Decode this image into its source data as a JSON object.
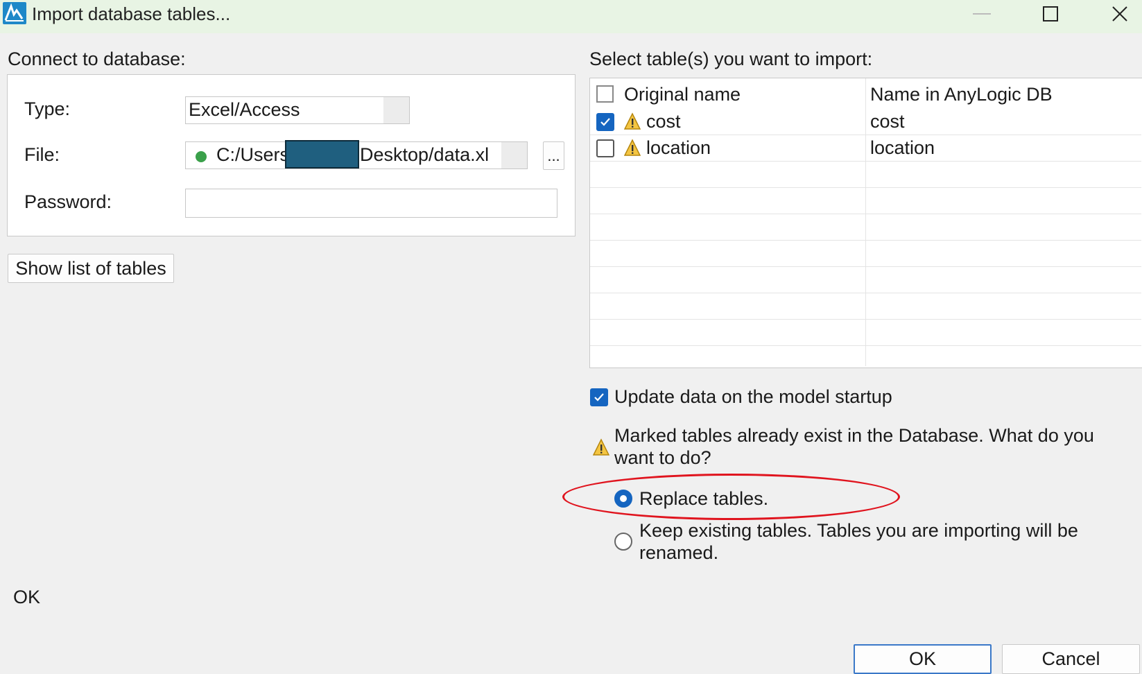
{
  "window": {
    "title": "Import database tables...",
    "icon": "anylogic-app-icon",
    "controls": [
      "minimize",
      "maximize",
      "close"
    ]
  },
  "connect": {
    "group_label": "Connect to database:",
    "type_label": "Type:",
    "type_value": "Excel/Access",
    "file_label": "File:",
    "file_value_prefix": "C:/Users",
    "file_value_suffix": "Desktop/data.xl",
    "file_status_color": "#3aa04a",
    "browse_label": "...",
    "password_label": "Password:",
    "password_value": "",
    "show_tables_label": "Show list of tables"
  },
  "tables": {
    "group_label": "Select table(s) you want to import:",
    "columns": [
      "Original name",
      "Name in AnyLogic DB"
    ],
    "rows": [
      {
        "checked": true,
        "warning": true,
        "original": "cost",
        "anylogic": "cost"
      },
      {
        "checked": false,
        "warning": true,
        "original": "location",
        "anylogic": "location"
      }
    ]
  },
  "options": {
    "update_label": "Update data on the model startup",
    "update_checked": true,
    "warning_text": "Marked tables already exist in the Database. What do you want to do?",
    "replace_label": "Replace tables.",
    "replace_selected": true,
    "keep_label": "Keep existing tables. Tables you are importing will be renamed.",
    "keep_selected": false
  },
  "status": {
    "text": "OK"
  },
  "footer": {
    "ok_label": "OK",
    "cancel_label": "Cancel"
  },
  "colors": {
    "accent": "#1565c0",
    "annotation": "#e0141e",
    "titlebar": "#e8f4e4"
  }
}
